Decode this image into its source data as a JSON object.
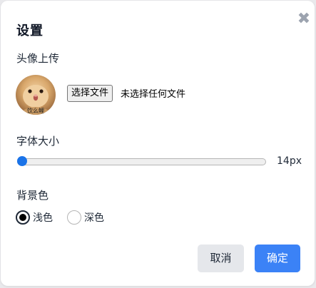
{
  "dialog": {
    "title": "设置",
    "close_icon": "close-icon"
  },
  "avatar_section": {
    "label": "头像上传",
    "file_button": "选择文件",
    "file_status": "未选择任何文件",
    "avatar_caption": "饮么鲤"
  },
  "font_size": {
    "label": "字体大小",
    "value_text": "14px",
    "slider_fraction": 0.0
  },
  "background": {
    "label": "背景色",
    "options": [
      {
        "label": "浅色",
        "checked": true
      },
      {
        "label": "深色",
        "checked": false
      }
    ]
  },
  "footer": {
    "cancel": "取消",
    "ok": "确定"
  },
  "colors": {
    "accent": "#3b82f6",
    "slider": "#1a73e8"
  }
}
